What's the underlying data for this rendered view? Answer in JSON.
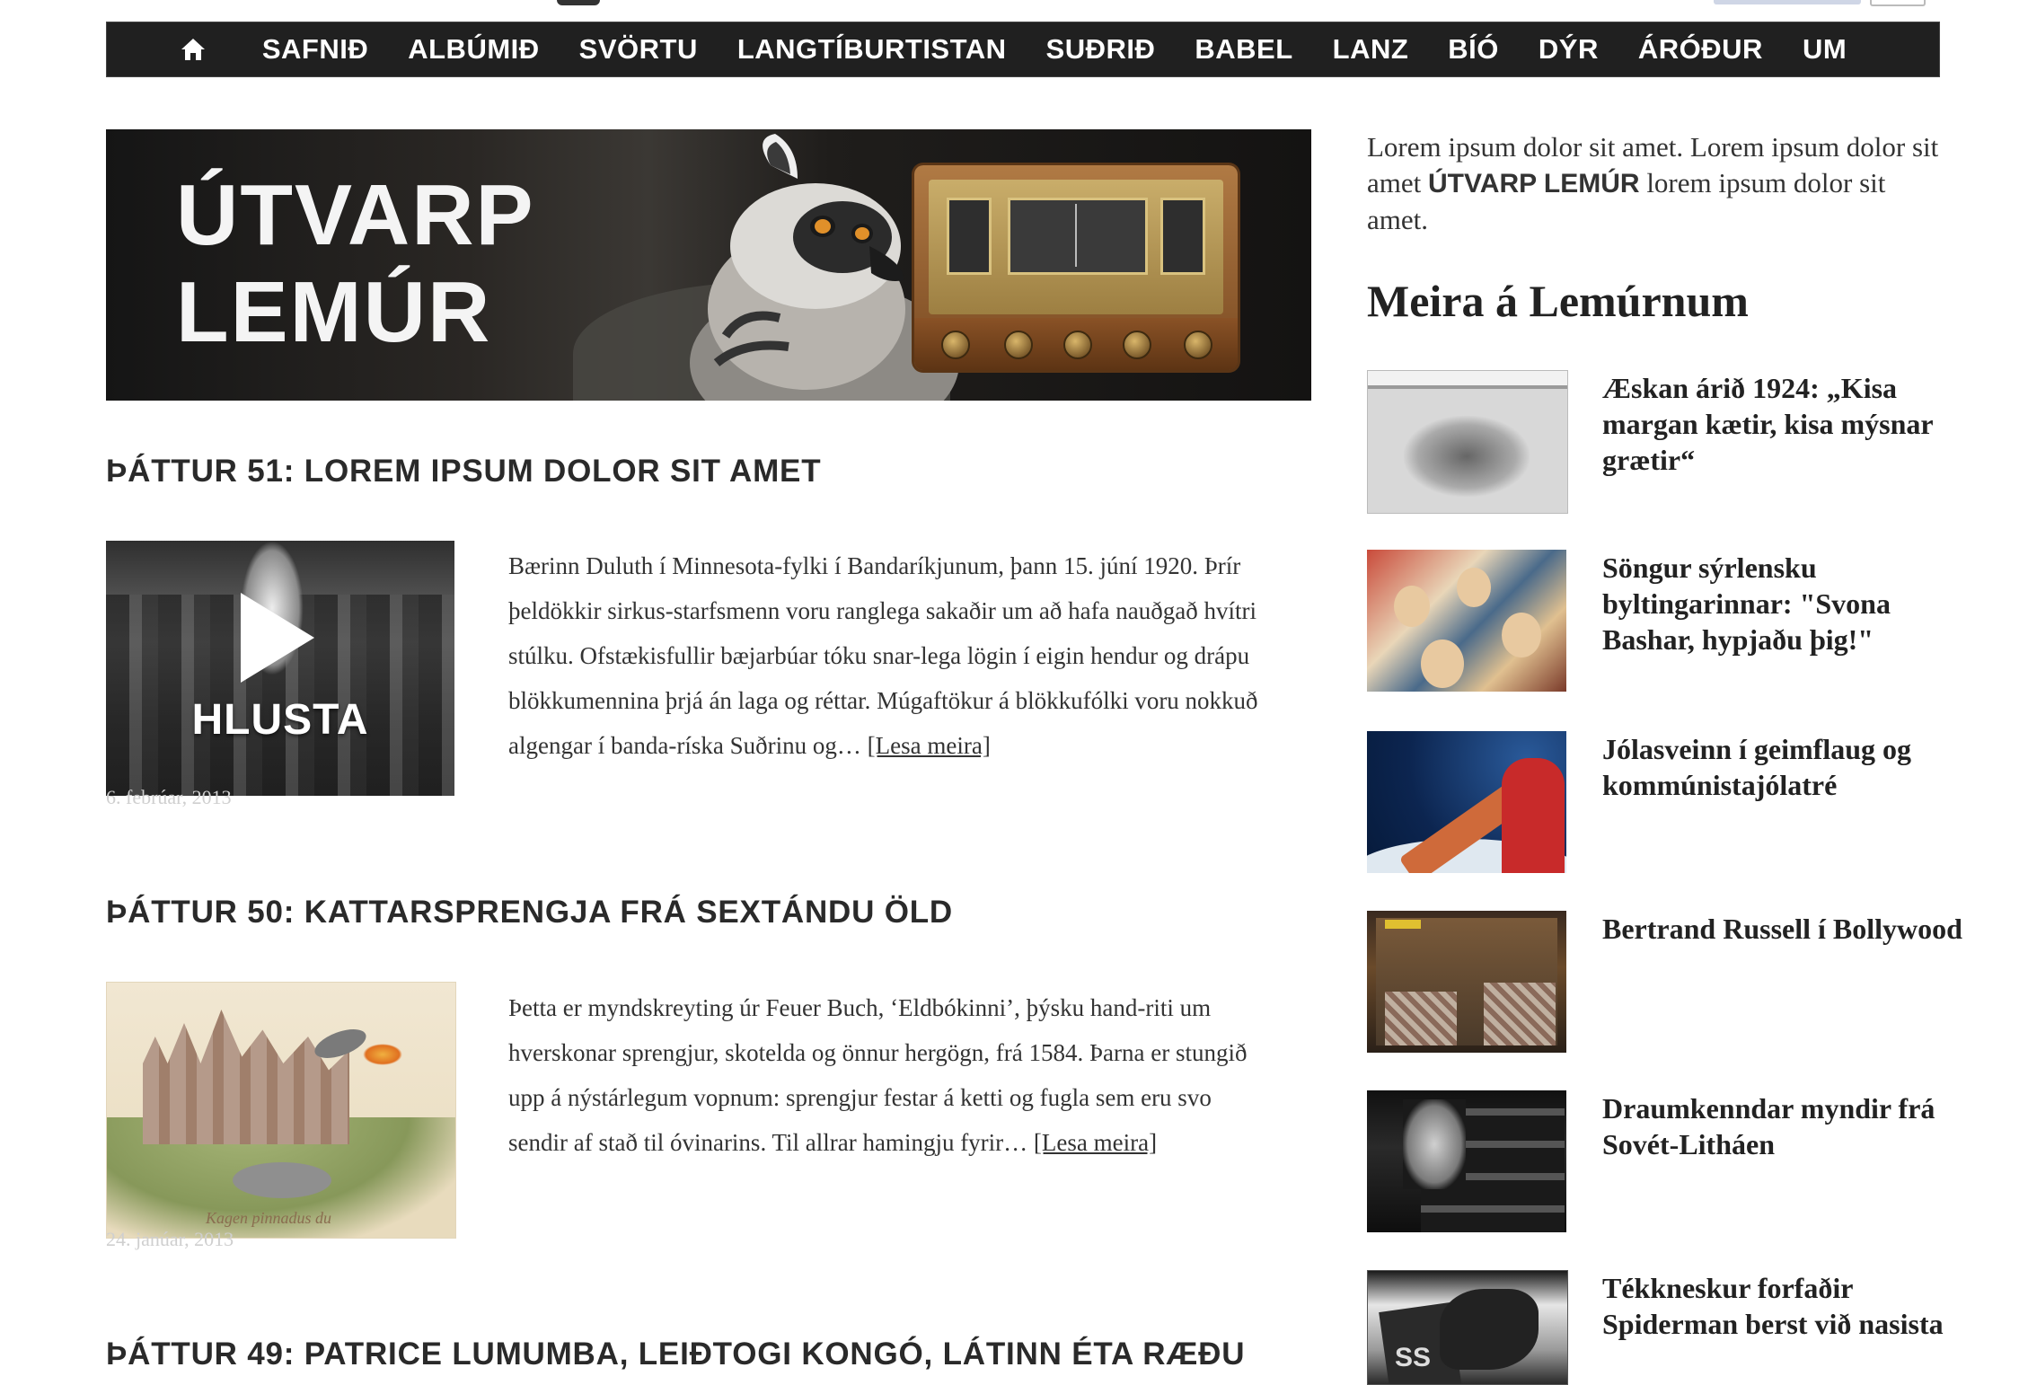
{
  "nav": {
    "home_icon": "home-icon",
    "items": [
      "SAFNIÐ",
      "ALBÚMIÐ",
      "SVÖRTU",
      "LANGTÍBURTISTAN",
      "SUÐRIÐ",
      "BABEL",
      "LANZ",
      "BÍÓ",
      "DÝR",
      "ÁRÓÐUR",
      "UM"
    ]
  },
  "banner": {
    "line1": "ÚTVARP",
    "line2": "LEMÚR"
  },
  "posts": [
    {
      "title": "ÞÁTTUR 51: LOREM IPSUM DOLOR SIT AMET",
      "thumb_label": "HLUSTA",
      "date": "6. febrúar, 2013",
      "excerpt": "Bærinn Duluth í Minnesota-fylki í Bandaríkjunum, þann 15. júní 1920.   Þrír þeldökkir sirkus-starfsmenn voru ranglega sakaðir um að hafa nauðgað hvítri stúlku. Ofstækisfullir bæjarbúar tóku snar-lega lögin í eigin hendur og drápu blökkumennina þrjá án laga og réttar.   Múgaftökur á blökkufólki voru nokkuð algengar í banda-ríska Suðrinu og…",
      "more": "[Lesa meira]"
    },
    {
      "title": "ÞÁTTUR 50: KATTARSPRENGJA FRÁ SEXTÁNDU ÖLD",
      "thumb_caption": "Kagen pinnadus du",
      "date": "24. janúar, 2013",
      "excerpt": "Þetta er myndskreyting úr Feuer Buch, ‘Eldbókinni’, þýsku hand-riti um hverskonar sprengjur, skotelda og önnur hergögn, frá 1584. Þarna er stungið upp á nýstárlegum vopnum: sprengjur festar á ketti og fugla sem eru svo sendir af stað til óvinarins.   Til allrar hamingju fyrir…",
      "more": "[Lesa meira]"
    },
    {
      "title": "ÞÁTTUR 49: PATRICE LUMUMBA, LEIÐTOGI KONGÓ, LÁTINN ÉTA RÆÐU"
    }
  ],
  "sidebar": {
    "intro_before": "Lorem ipsum dolor sit amet. Lorem ipsum dolor sit amet ",
    "intro_brand": "ÚTVARP LEMÚR",
    "intro_after": " lorem ipsum dolor sit amet.",
    "heading": "Meira á Lemúrnum",
    "items": [
      {
        "title": "Æskan árið 1924: „Kisa margan kætir, kisa mýsnar grætir“"
      },
      {
        "title": "Söngur sýrlensku byltingarinnar: \"Svona Bashar, hypjaðu þig!\""
      },
      {
        "title": "Jólasveinn í geimflaug og kommúnistajólatré"
      },
      {
        "title": "Bertrand Russell í Bollywood"
      },
      {
        "title": "Draumkenndar myndir frá Sovét-Litháen"
      },
      {
        "title": "Tékkneskur forfaðir Spiderman berst við nasista"
      }
    ],
    "item6_thumb_text": "SS"
  },
  "colors": {
    "nav_bg": "#202020",
    "nav_text": "#ffffff",
    "title_text": "#2a2a2a",
    "date_text": "#cfcfcf"
  }
}
